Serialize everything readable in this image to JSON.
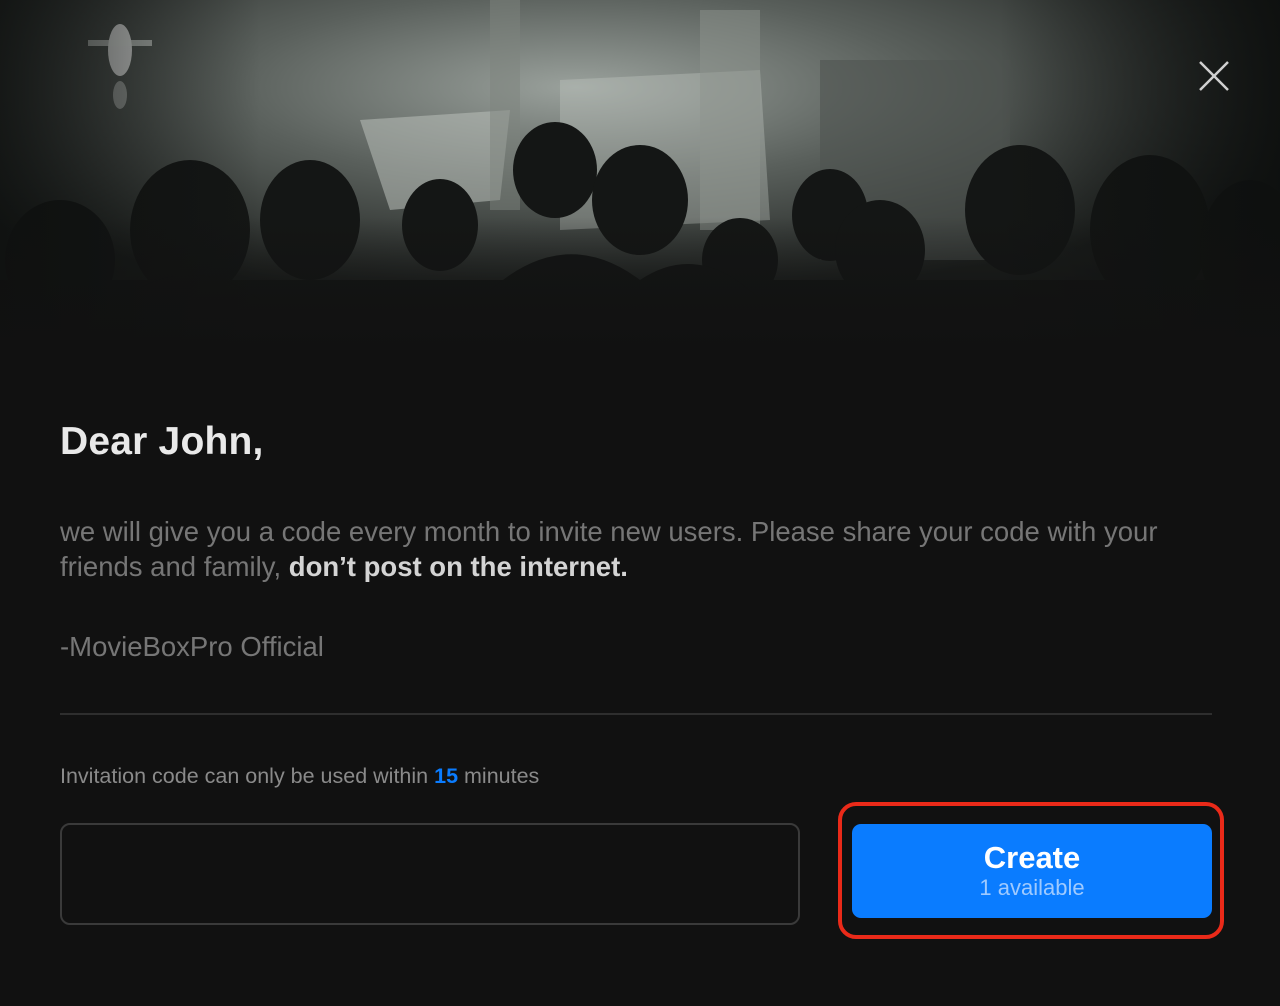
{
  "hero": {
    "image_description_icon": "theater-audience-image"
  },
  "close": {
    "icon": "close-icon"
  },
  "greeting": "Dear John,",
  "message": {
    "text": "we will give you a code every month to invite new users. Please share your code with your friends and family, ",
    "emphasis": "don’t post on the internet."
  },
  "signature": "-MovieBoxPro Official",
  "notice": {
    "prefix": "Invitation code can only be used within ",
    "minutes": "15",
    "suffix": " minutes"
  },
  "code_input": {
    "value": ""
  },
  "create_button": {
    "label": "Create",
    "availability": "1 available"
  },
  "colors": {
    "background": "#111111",
    "accent": "#0a7cff",
    "highlight": "#ea2a19",
    "muted_text": "#767676",
    "heading_text": "#e9e9e9"
  }
}
